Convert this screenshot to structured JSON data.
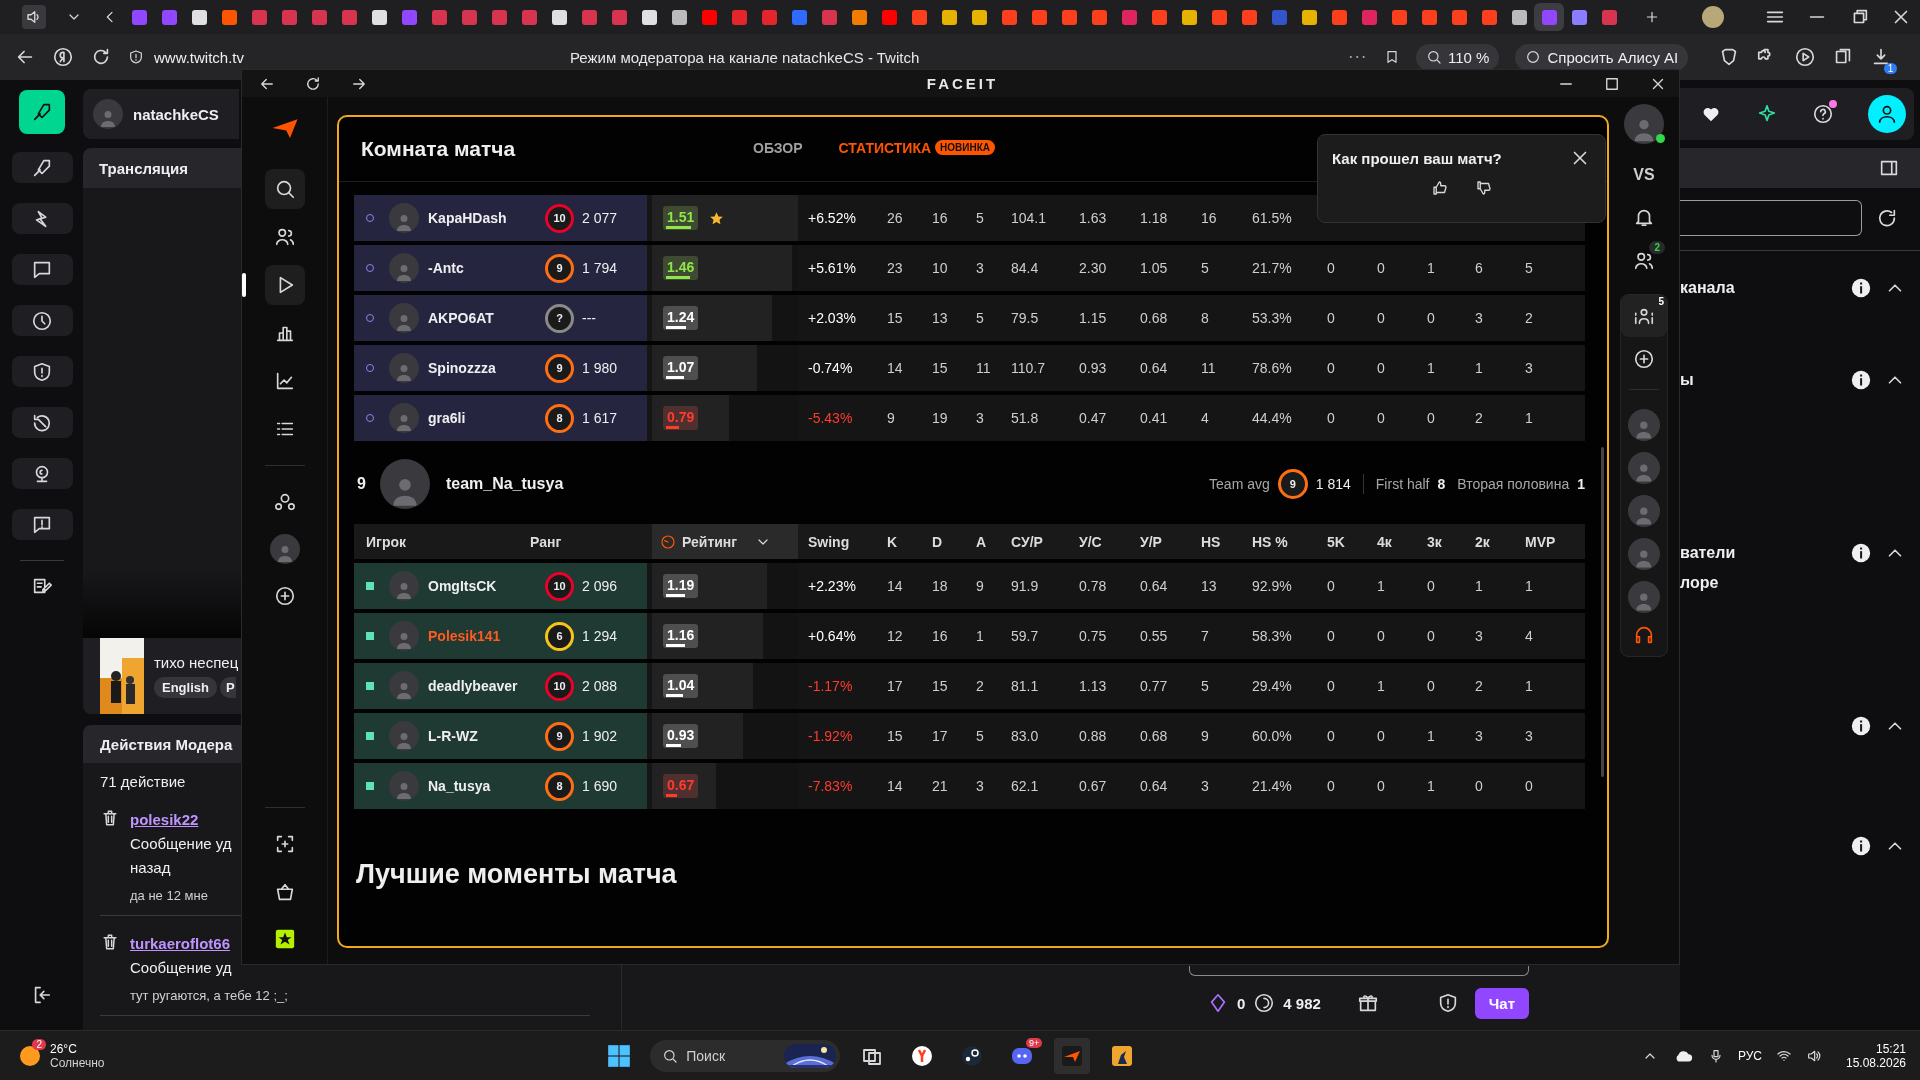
{
  "browser": {
    "tabs": [
      {
        "color": "#9146ff",
        "selected": false
      },
      {
        "color": "#9146ff",
        "selected": false
      },
      {
        "color": "#e0e0e0",
        "selected": false
      },
      {
        "color": "#ff5500",
        "selected": false
      },
      {
        "color": "#d6344f",
        "selected": false
      },
      {
        "color": "#d6344f",
        "selected": false
      },
      {
        "color": "#d6344f",
        "selected": false
      },
      {
        "color": "#d6344f",
        "selected": false
      },
      {
        "color": "#e0e0e0",
        "selected": false
      },
      {
        "color": "#9146ff",
        "selected": false
      },
      {
        "color": "#d6344f",
        "selected": false
      },
      {
        "color": "#d6344f",
        "selected": false
      },
      {
        "color": "#d6344f",
        "selected": false
      },
      {
        "color": "#d6344f",
        "selected": false
      },
      {
        "color": "#e0e0e0",
        "selected": false
      },
      {
        "color": "#d6344f",
        "selected": false
      },
      {
        "color": "#d6344f",
        "selected": false
      },
      {
        "color": "#e0e0e0",
        "selected": false
      },
      {
        "color": "#bbbbbb",
        "selected": false
      },
      {
        "color": "#ff0000",
        "selected": false
      },
      {
        "color": "#e3262b",
        "selected": false
      },
      {
        "color": "#e3262b",
        "selected": false
      },
      {
        "color": "#2f6bff",
        "selected": false
      },
      {
        "color": "#d6344f",
        "selected": false
      },
      {
        "color": "#f07c00",
        "selected": false
      },
      {
        "color": "#ff0000",
        "selected": false
      },
      {
        "color": "#fc3f1d",
        "selected": false
      },
      {
        "color": "#e6b400",
        "selected": false
      },
      {
        "color": "#e6b400",
        "selected": false
      },
      {
        "color": "#fc3f1d",
        "selected": false
      },
      {
        "color": "#fc3f1d",
        "selected": false
      },
      {
        "color": "#fc3f1d",
        "selected": false
      },
      {
        "color": "#fc3f1d",
        "selected": false
      },
      {
        "color": "#e0245e",
        "selected": false
      },
      {
        "color": "#fc3f1d",
        "selected": false
      },
      {
        "color": "#e6b400",
        "selected": false
      },
      {
        "color": "#fc3f1d",
        "selected": false
      },
      {
        "color": "#fc3f1d",
        "selected": false
      },
      {
        "color": "#3355cc",
        "selected": false
      },
      {
        "color": "#e6b400",
        "selected": false
      },
      {
        "color": "#fc3f1d",
        "selected": false
      },
      {
        "color": "#e0245e",
        "selected": false
      },
      {
        "color": "#fc3f1d",
        "selected": false
      },
      {
        "color": "#fc3f1d",
        "selected": false
      },
      {
        "color": "#fc3f1d",
        "selected": false
      },
      {
        "color": "#fc3f1d",
        "selected": false
      },
      {
        "color": "#bbbbbb",
        "selected": false
      },
      {
        "color": "#9146ff",
        "selected": true
      },
      {
        "color": "#8a7dff",
        "selected": false
      },
      {
        "color": "#d6344f",
        "selected": false
      }
    ],
    "url": "www.twitch.tv",
    "page_title": "Режим модератора на канале natachkeCS - Twitch",
    "zoom": "110 %",
    "assistant": "Спросить Алису AI",
    "download_badge": "1"
  },
  "twitch": {
    "channel": "natachkeCS",
    "stream_header": "Трансляция",
    "stream_title": "тихо неспец",
    "tags": [
      "English",
      "Р"
    ],
    "mod_header": "Действия Модера",
    "action_count": "71 действие",
    "actions": [
      {
        "user": "polesik22",
        "lines": [
          "Сообщение уд",
          "назад"
        ],
        "message": "да не 12 мне"
      },
      {
        "user": "turkaeroflot66",
        "lines": [
          "Сообщение уд"
        ],
        "message": "тут ругаются, а тебе 12 ;_;"
      }
    ],
    "sections": [
      {
        "title": "канала",
        "expanded": true
      },
      {
        "title": "ы",
        "expanded": true
      },
      {
        "title": "ватели",
        "items": [
          "лоре"
        ],
        "expanded": true
      },
      {
        "expanded": true
      },
      {
        "expanded": true
      }
    ],
    "chat_bar": {
      "points": "0",
      "coins": "4 982",
      "chat_button": "Чат"
    }
  },
  "faceit": {
    "logo": "FACEIT",
    "title": "Комната матча",
    "tabs": [
      {
        "label": "ОБЗОР",
        "selected": false
      },
      {
        "label": "СТАТИСТИКА",
        "selected": true,
        "badge": "НОВИНКА"
      }
    ],
    "feedback": {
      "question": "Как прошел ваш матч?"
    },
    "columns": [
      "Игрок",
      "Ранг",
      "Рейтинг",
      "Swing",
      "K",
      "D",
      "A",
      "СУ/Р",
      "У/С",
      "У/Р",
      "HS",
      "HS %",
      "5K",
      "4к",
      "3к",
      "2к",
      "MVP"
    ],
    "teams": [
      {
        "kind": "circle",
        "rows": [
          {
            "name": "KapaHDash",
            "highlighted": false,
            "rank": {
              "value": "10",
              "color": "#e80128"
            },
            "elo": "2 077",
            "rating": {
              "value": "1.51",
              "color": "#8fe54a",
              "level": 1.0
            },
            "top": true,
            "swing": {
              "value": "+6.52%",
              "negative": false
            },
            "stats": [
              "26",
              "16",
              "5",
              "104.1",
              "1.63",
              "1.18",
              "16",
              "61.5%"
            ]
          },
          {
            "name": "-Antc",
            "highlighted": false,
            "rank": {
              "value": "9",
              "color": "#fe6e13"
            },
            "elo": "1 794",
            "rating": {
              "value": "1.46",
              "color": "#8fe54a",
              "level": 0.96
            },
            "top": false,
            "swing": {
              "value": "+5.61%",
              "negative": false
            },
            "stats": [
              "23",
              "10",
              "3",
              "84.4",
              "2.30",
              "1.05",
              "5",
              "21.7%",
              "0",
              "0",
              "1",
              "6",
              "5"
            ]
          },
          {
            "name": "AKPO6AT",
            "highlighted": false,
            "rank": {
              "value": "?",
              "color": "#8a8a8a"
            },
            "elo": "---",
            "rating": {
              "value": "1.24",
              "color": "#ffffff",
              "level": 0.82
            },
            "top": false,
            "swing": {
              "value": "+2.03%",
              "negative": false
            },
            "stats": [
              "15",
              "13",
              "5",
              "79.5",
              "1.15",
              "0.68",
              "8",
              "53.3%",
              "0",
              "0",
              "0",
              "3",
              "2"
            ]
          },
          {
            "name": "Spinozzza",
            "highlighted": false,
            "rank": {
              "value": "9",
              "color": "#fe6e13"
            },
            "elo": "1 980",
            "rating": {
              "value": "1.07",
              "color": "#ffffff",
              "level": 0.72
            },
            "top": false,
            "swing": {
              "value": "-0.74%",
              "negative": false
            },
            "stats": [
              "14",
              "15",
              "11",
              "110.7",
              "0.93",
              "0.64",
              "11",
              "78.6%",
              "0",
              "0",
              "1",
              "1",
              "3"
            ]
          },
          {
            "name": "gra6li",
            "highlighted": false,
            "rank": {
              "value": "8",
              "color": "#fe6e13"
            },
            "elo": "1 617",
            "rating": {
              "value": "0.79",
              "color": "#ff3b30",
              "level": 0.53
            },
            "top": false,
            "swing": {
              "value": "-5.43%",
              "negative": true
            },
            "stats": [
              "9",
              "19",
              "3",
              "51.8",
              "0.47",
              "0.41",
              "4",
              "44.4%",
              "0",
              "0",
              "0",
              "2",
              "1"
            ]
          }
        ]
      },
      {
        "kind": "square",
        "score": "9",
        "name": "team_Na_tusya",
        "avg_label": "Team avg",
        "avg_rank": {
          "value": "9",
          "color": "#fe6e13"
        },
        "avg_elo": "1 814",
        "first_half_label": "First half",
        "first_half": "8",
        "second_half_label": "Вторая половина",
        "second_half": "1",
        "rows": [
          {
            "name": "OmgItsCK",
            "highlighted": false,
            "rank": {
              "value": "10",
              "color": "#e80128"
            },
            "elo": "2 096",
            "rating": {
              "value": "1.19",
              "color": "#ffffff",
              "level": 0.79
            },
            "top": false,
            "swing": {
              "value": "+2.23%",
              "negative": false
            },
            "stats": [
              "14",
              "18",
              "9",
              "91.9",
              "0.78",
              "0.64",
              "13",
              "92.9%",
              "0",
              "1",
              "0",
              "1",
              "1"
            ]
          },
          {
            "name": "Polesik141",
            "highlighted": true,
            "rank": {
              "value": "6",
              "color": "#f5c518"
            },
            "elo": "1 294",
            "rating": {
              "value": "1.16",
              "color": "#ffffff",
              "level": 0.76
            },
            "top": false,
            "swing": {
              "value": "+0.64%",
              "negative": false
            },
            "stats": [
              "12",
              "16",
              "1",
              "59.7",
              "0.75",
              "0.55",
              "7",
              "58.3%",
              "0",
              "0",
              "0",
              "3",
              "4"
            ]
          },
          {
            "name": "deadlybeaver",
            "highlighted": false,
            "rank": {
              "value": "10",
              "color": "#e80128"
            },
            "elo": "2 088",
            "rating": {
              "value": "1.04",
              "color": "#ffffff",
              "level": 0.69
            },
            "top": false,
            "swing": {
              "value": "-1.17%",
              "negative": true
            },
            "stats": [
              "17",
              "15",
              "2",
              "81.1",
              "1.13",
              "0.77",
              "5",
              "29.4%",
              "0",
              "1",
              "0",
              "2",
              "1"
            ]
          },
          {
            "name": "L-R-WZ",
            "highlighted": false,
            "rank": {
              "value": "9",
              "color": "#fe6e13"
            },
            "elo": "1 902",
            "rating": {
              "value": "0.93",
              "color": "#ffffff",
              "level": 0.62
            },
            "top": false,
            "swing": {
              "value": "-1.92%",
              "negative": true
            },
            "stats": [
              "15",
              "17",
              "5",
              "83.0",
              "0.88",
              "0.68",
              "9",
              "60.0%",
              "0",
              "0",
              "1",
              "3",
              "3"
            ]
          },
          {
            "name": "Na_tusya",
            "highlighted": false,
            "rank": {
              "value": "8",
              "color": "#fe6e13"
            },
            "elo": "1 690",
            "rating": {
              "value": "0.67",
              "color": "#ff3b30",
              "level": 0.44
            },
            "top": false,
            "swing": {
              "value": "-7.83%",
              "negative": true
            },
            "stats": [
              "14",
              "21",
              "3",
              "62.1",
              "0.67",
              "0.64",
              "3",
              "21.4%",
              "0",
              "0",
              "1",
              "0",
              "0"
            ]
          }
        ]
      }
    ],
    "section_title": "Лучшие моменты матча",
    "rail": {
      "online": true,
      "vs": "VS",
      "friends_badge": "2",
      "party_badge": "5"
    }
  },
  "taskbar": {
    "weather_badge": "2",
    "temp": "26°C",
    "condition": "Солнечно",
    "search": "Поиск",
    "discord_badge": "9+",
    "language": "РУС",
    "time": "15:21",
    "date": "15.08.2026"
  }
}
